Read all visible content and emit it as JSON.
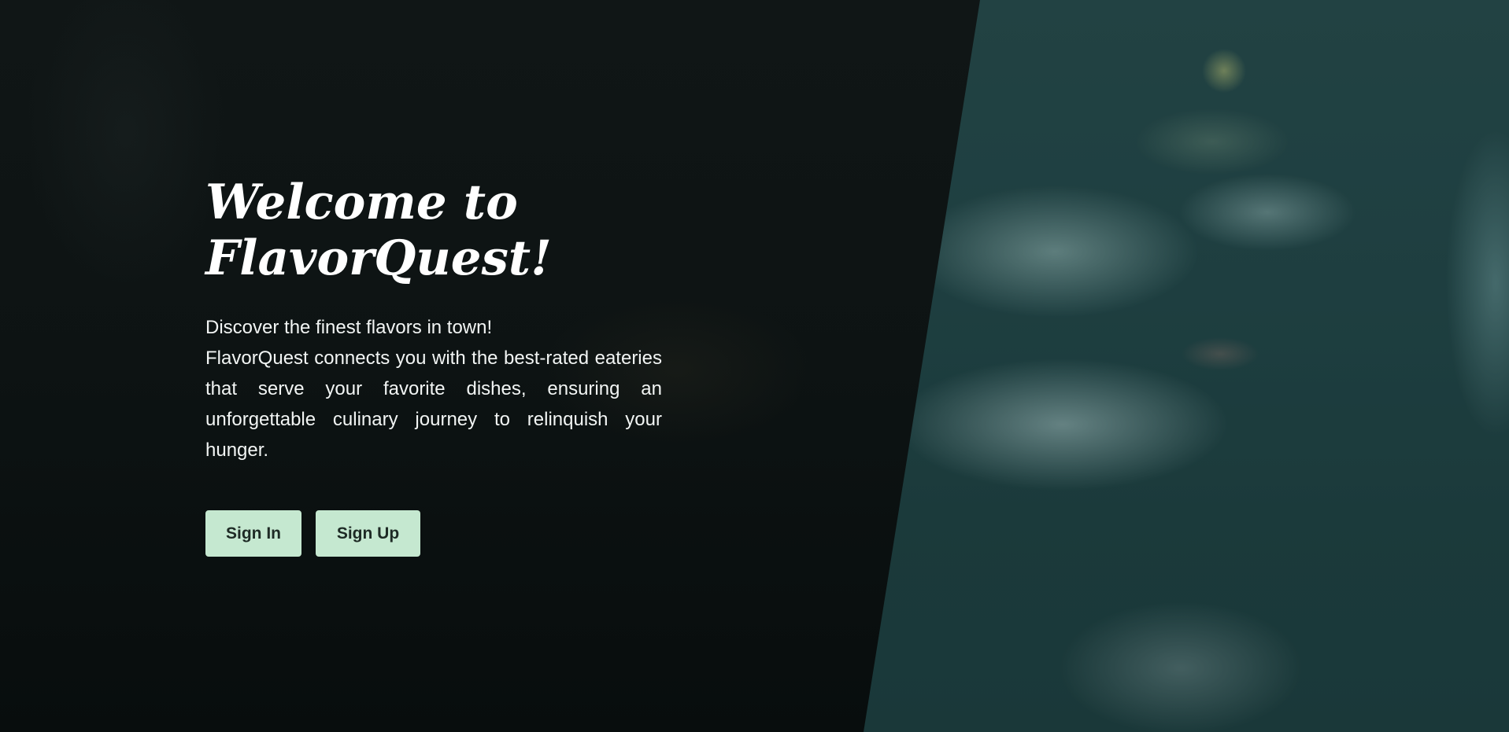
{
  "hero": {
    "title_line1": "Welcome to",
    "title_line2": "FlavorQuest!",
    "tagline": "Discover the finest flavors in town!",
    "description": "FlavorQuest connects you with the best-rated eateries that serve your favorite dishes, ensuring an unforgettable culinary journey to relinquish your hunger."
  },
  "actions": {
    "sign_in_label": "Sign In",
    "sign_up_label": "Sign Up"
  },
  "colors": {
    "button_background": "#c5e8d0",
    "button_text": "#1e2a25",
    "panel_background": "#0d1313",
    "photo_tint": "#1f3a3b",
    "text": "#ffffff"
  }
}
